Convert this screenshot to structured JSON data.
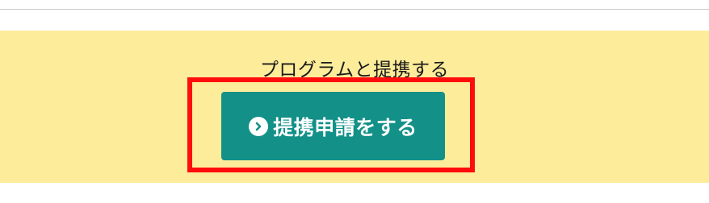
{
  "section": {
    "heading": "プログラムと提携する",
    "apply_button_label": "提携申請をする",
    "apply_button_icon": "chevron-right-circle-icon"
  },
  "colors": {
    "panel_background": "#fdec9a",
    "button_background": "#139088",
    "highlight_border": "#ff0c0c"
  }
}
